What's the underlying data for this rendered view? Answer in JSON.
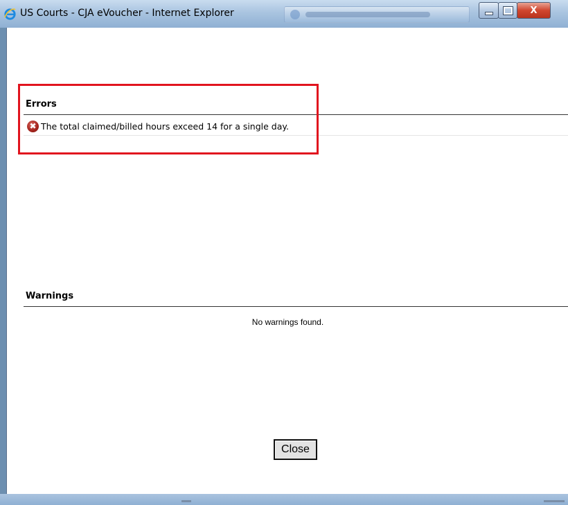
{
  "window": {
    "title": "US Courts - CJA eVoucher - Internet Explorer",
    "icon": "internet-explorer-icon",
    "controls": {
      "minimize": "minimize-icon",
      "maximize": "maximize-icon",
      "close": "X"
    }
  },
  "errors": {
    "heading": "Errors",
    "items": [
      {
        "icon": "error-icon",
        "glyph": "✖",
        "text": "The total claimed/billed hours exceed 14 for a single day."
      }
    ],
    "highlight_color": "#e1141e"
  },
  "warnings": {
    "heading": "Warnings",
    "empty_text": "No warnings found."
  },
  "actions": {
    "close_label": "Close"
  }
}
